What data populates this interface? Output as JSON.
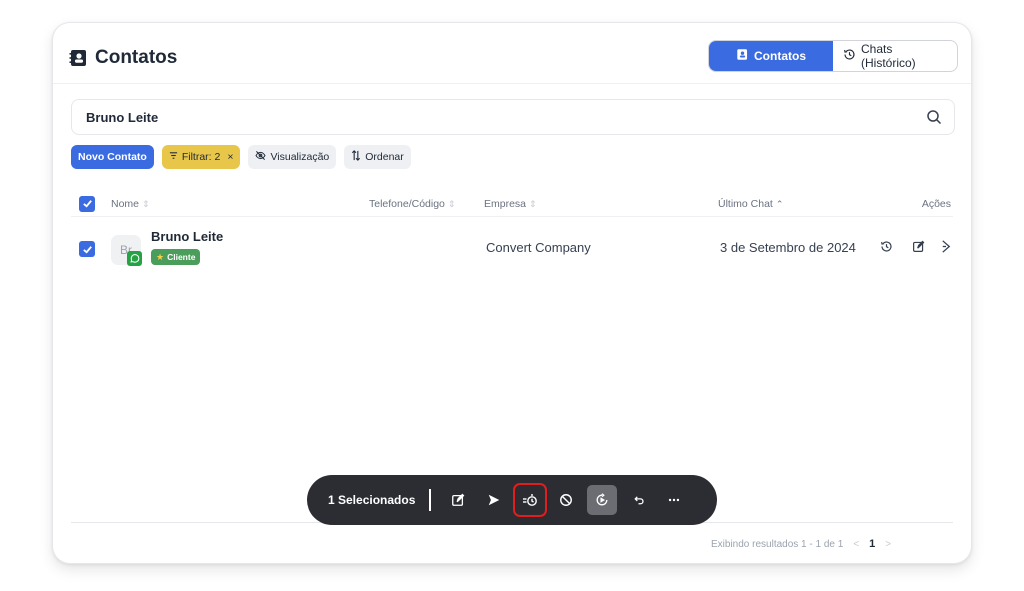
{
  "header": {
    "title": "Contatos",
    "tabs": [
      {
        "label": "Contatos",
        "active": true
      },
      {
        "label": "Chats (Histórico)",
        "active": false
      }
    ]
  },
  "search": {
    "value": "Bruno Leite"
  },
  "toolbar": {
    "new_contact": "Novo Contato",
    "filter": "Filtrar: 2",
    "filter_clear": "×",
    "view": "Visualização",
    "sort": "Ordenar"
  },
  "table": {
    "columns": {
      "name": "Nome",
      "phone": "Telefone/Código",
      "company": "Empresa",
      "last_chat": "Último Chat",
      "actions": "Ações"
    },
    "rows": [
      {
        "initials": "Br",
        "name": "Bruno Leite",
        "badge": "Cliente",
        "phone": "",
        "company": "Convert Company",
        "last_chat": "3 de Setembro de 2024",
        "selected": true
      }
    ]
  },
  "selection_bar": {
    "label": "1 Selecionados",
    "icons": [
      "edit-icon",
      "send-icon",
      "schedule-transfer-icon",
      "block-icon",
      "restore-icon",
      "undo-icon",
      "more-icon"
    ]
  },
  "pagination": {
    "summary": "Exibindo resultados 1 - 1 de 1",
    "prev": "<",
    "current": "1",
    "next": ">"
  },
  "colors": {
    "primary": "#3b6be0",
    "filter_yellow": "#e8c64a",
    "badge_green": "#4a9d5b",
    "whatsapp_green": "#25a244",
    "bar_dark": "#2b2d33",
    "highlight_red": "#e11d1d"
  }
}
